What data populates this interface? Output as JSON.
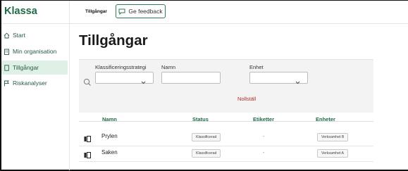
{
  "app": {
    "brand": "Klassa"
  },
  "header": {
    "breadcrumb": "Tillgångar",
    "feedback_label": "Ge feedback"
  },
  "sidebar": {
    "items": [
      {
        "label": "Start",
        "icon": "home-icon",
        "active": false
      },
      {
        "label": "Min organisation",
        "icon": "building-icon",
        "active": false
      },
      {
        "label": "Tillgångar",
        "icon": "file-icon",
        "active": true
      },
      {
        "label": "Riskanalyser",
        "icon": "flag-icon",
        "active": false
      }
    ]
  },
  "main": {
    "title": "Tillgångar",
    "filters": {
      "strategy_label": "Klassificeringsstrategi",
      "name_label": "Namn",
      "unit_label": "Enhet",
      "strategy_value": "",
      "name_value": "",
      "unit_value": "",
      "reset_label": "Nollställ"
    },
    "table": {
      "columns": [
        "Namn",
        "Status",
        "Etiketter",
        "Enheter"
      ],
      "rows": [
        {
          "icon": "document-icon",
          "name": "Prylen",
          "status": "Klassificerad",
          "tags": "-",
          "unit": "Verksamhet B"
        },
        {
          "icon": "document-icon",
          "name": "Saken",
          "status": "Klassificerad",
          "tags": "-",
          "unit": "Verksamhet A"
        }
      ]
    }
  },
  "colors": {
    "brand": "#1f6b46",
    "active_bg": "#dff1e6",
    "reset": "#b02a2a"
  }
}
